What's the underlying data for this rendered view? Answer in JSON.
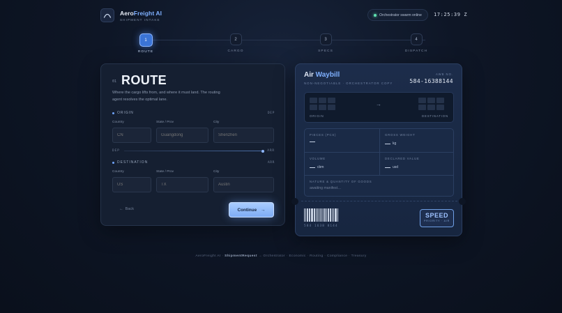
{
  "brand": {
    "name_part1": "Aero",
    "name_part2": "Freight AI",
    "subtitle": "SHIPMENT INTAKE"
  },
  "status": {
    "text": "Orchestrator swarm online",
    "clock": "17:25:39 Z"
  },
  "colors": {
    "accent": "#7fb0ff",
    "status_online": "#5fe0b0",
    "background": "#0e1626"
  },
  "steps": [
    {
      "num": "1",
      "label": "ROUTE",
      "active": true
    },
    {
      "num": "2",
      "label": "CARGO",
      "active": false
    },
    {
      "num": "3",
      "label": "SPECS",
      "active": false
    },
    {
      "num": "4",
      "label": "DISPATCH",
      "active": false
    }
  ],
  "route_form": {
    "section_num": "01",
    "title": "ROUTE",
    "description": "Where the cargo lifts from, and where it must land. The routing agent resolves the optimal lane.",
    "origin": {
      "label": "ORIGIN",
      "code": "DEP",
      "country_label": "Country",
      "country_placeholder": "CN",
      "state_label": "State / Prov",
      "state_placeholder": "Guangdong",
      "city_label": "City",
      "city_placeholder": "Shenzhen"
    },
    "divider": {
      "left": "DEP",
      "right": "ARR"
    },
    "destination": {
      "label": "DESTINATION",
      "code": "ARR",
      "country_label": "Country",
      "country_placeholder": "US",
      "state_label": "State / Prov",
      "state_placeholder": "TX",
      "city_label": "City",
      "city_placeholder": "Austin"
    },
    "back_label": "Back",
    "continue_label": "Continue"
  },
  "waybill": {
    "title_part1": "Air ",
    "title_part2": "Waybill",
    "subtitle": "NON-NEGOTIABLE · ORCHESTRATOR COPY",
    "awb_label": "AWB NO.",
    "awb_number": "584-16388144",
    "origin_label": "ORIGIN",
    "destination_label": "DESTINATION",
    "pieces_label": "PIECES (PCS)",
    "gross_weight_label": "GROSS WEIGHT",
    "gross_weight_unit": "kg",
    "volume_label": "VOLUME",
    "volume_unit": "cbm",
    "declared_value_label": "DECLARED VALUE",
    "declared_value_unit": "usd",
    "goods_label": "NATURE & QUANTITY OF GOODS",
    "goods_value": "awaiting manifest…",
    "barcode_number": "584 1638 8144",
    "stamp_big": "SPEED",
    "stamp_small": "PRIORITY · AIR"
  },
  "footer": {
    "prefix": "AeroFreight AI ·",
    "entity": "ShipmentRequest",
    "chain": "→ Orchestrator · Economic · Routing · Compliance · Treasury"
  }
}
